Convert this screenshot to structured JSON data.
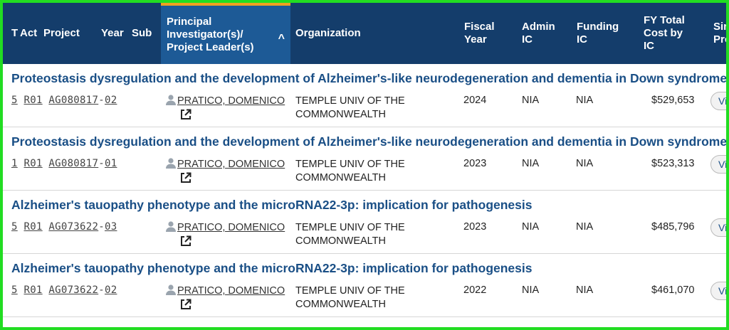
{
  "header": {
    "columns": {
      "type": "T",
      "act": "Act",
      "project": "Project",
      "year": "Year",
      "sub": "Sub",
      "pi": "Principal Investigator(s)/ Project Leader(s)",
      "org": "Organization",
      "fiscal_year": "Fiscal Year",
      "admin_ic": "Admin IC",
      "funding_ic": "Funding IC",
      "fy_total": "FY Total Cost by IC",
      "similar": "Sir Pro"
    },
    "sort_indicator": "^"
  },
  "rows": [
    {
      "title": "Proteostasis dysregulation and the development of Alzheimer's-like neurodegeneration and dementia in Down syndrome",
      "type": "5",
      "act": "R01",
      "ic_serial": "AG080817",
      "sep": "-",
      "sub": "02",
      "pi": "PRATICO, DOMENICO",
      "org_line1": "TEMPLE UNIV OF THE",
      "org_line2": "COMMONWEALTH",
      "fy": "2024",
      "admin": "NIA",
      "funding": "NIA",
      "cost": "$529,653",
      "view": "Vi"
    },
    {
      "title": "Proteostasis dysregulation and the development of Alzheimer's-like neurodegeneration and dementia in Down syndrome",
      "type": "1",
      "act": "R01",
      "ic_serial": "AG080817",
      "sep": "-",
      "sub": "01",
      "pi": "PRATICO, DOMENICO",
      "org_line1": "TEMPLE UNIV OF THE",
      "org_line2": "COMMONWEALTH",
      "fy": "2023",
      "admin": "NIA",
      "funding": "NIA",
      "cost": "$523,313",
      "view": "Vi"
    },
    {
      "title": "Alzheimer's tauopathy phenotype and the microRNA22-3p: implication for pathogenesis",
      "type": "5",
      "act": "R01",
      "ic_serial": "AG073622",
      "sep": "-",
      "sub": "03",
      "pi": "PRATICO, DOMENICO",
      "org_line1": "TEMPLE UNIV OF THE",
      "org_line2": "COMMONWEALTH",
      "fy": "2023",
      "admin": "NIA",
      "funding": "NIA",
      "cost": "$485,796",
      "view": "Vi"
    },
    {
      "title": "Alzheimer's tauopathy phenotype and the microRNA22-3p: implication for pathogenesis",
      "type": "5",
      "act": "R01",
      "ic_serial": "AG073622",
      "sep": "-",
      "sub": "02",
      "pi": "PRATICO, DOMENICO",
      "org_line1": "TEMPLE UNIV OF THE",
      "org_line2": "COMMONWEALTH",
      "fy": "2022",
      "admin": "NIA",
      "funding": "NIA",
      "cost": "$461,070",
      "view": "Vi"
    }
  ],
  "colors": {
    "header_bg": "#143d6b",
    "sorted_bg": "#1d5a96",
    "sort_accent": "#f0a020",
    "title": "#1a4f86",
    "frame": "#22dd22"
  }
}
